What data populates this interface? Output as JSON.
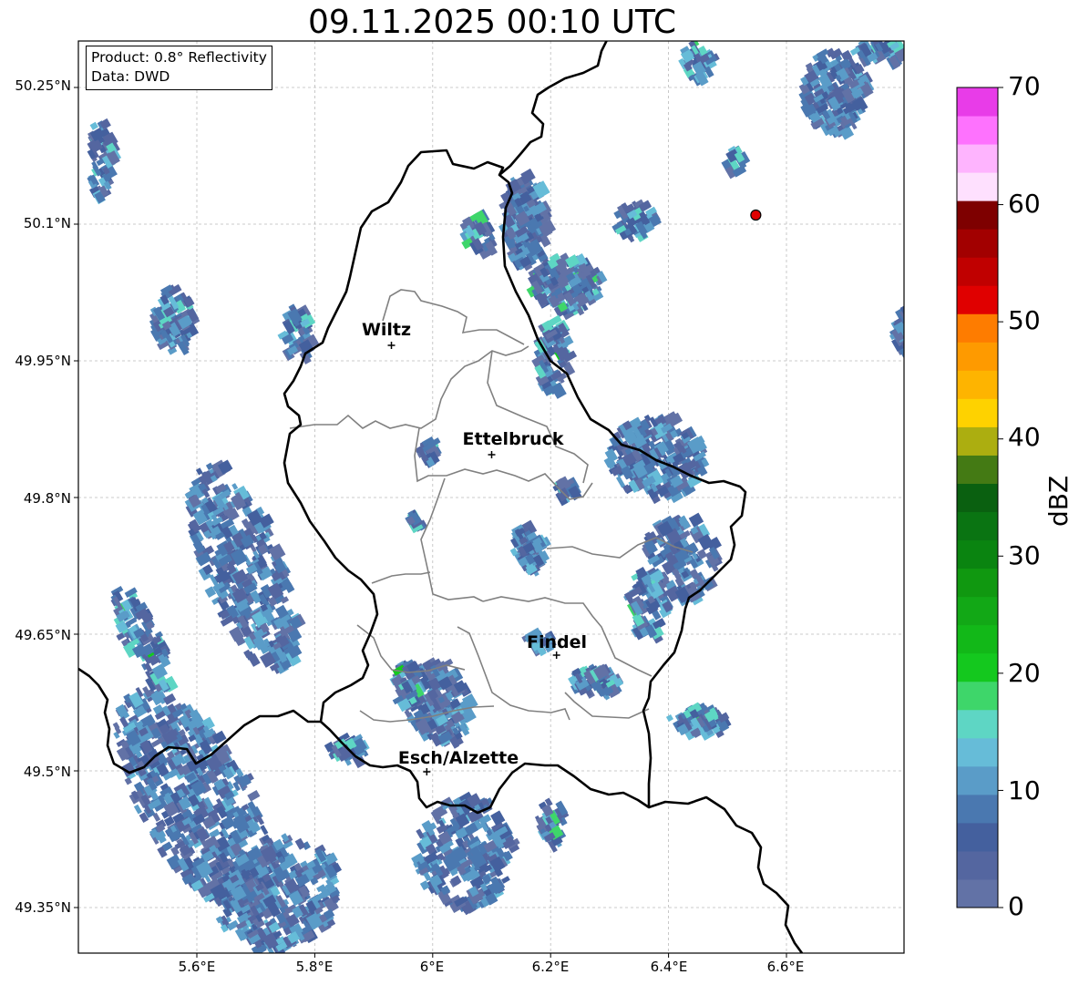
{
  "title": "09.11.2025 00:10 UTC",
  "info": {
    "product": "Product: 0.8° Reflectivity",
    "data": "Data: DWD"
  },
  "axes": {
    "lat_ticks": [
      "50.25°N",
      "50.1°N",
      "49.95°N",
      "49.8°N",
      "49.65°N",
      "49.5°N",
      "49.35°N"
    ],
    "lon_ticks": [
      "5.6°E",
      "5.8°E",
      "6°E",
      "6.2°E",
      "6.4°E",
      "6.6°E"
    ]
  },
  "cities": [
    {
      "name": "Wiltz",
      "lon": 5.93,
      "lat": 49.967
    },
    {
      "name": "Ettelbruck",
      "lon": 6.1,
      "lat": 49.847
    },
    {
      "name": "Findel",
      "lon": 6.21,
      "lat": 49.627
    },
    {
      "name": "Esch/Alzette",
      "lon": 5.99,
      "lat": 49.499
    }
  ],
  "radar_site": {
    "lon": 6.548,
    "lat": 50.11,
    "color": "#e00000"
  },
  "colorbar": {
    "label": "dBZ",
    "ticks": [
      "0",
      "10",
      "20",
      "30",
      "40",
      "50",
      "60",
      "70"
    ],
    "colors": [
      "#6272a6",
      "#5466a0",
      "#44609e",
      "#4a78b0",
      "#5a9cc8",
      "#66bcd8",
      "#5ed6c4",
      "#3ed66a",
      "#14c81e",
      "#12b818",
      "#12a816",
      "#109810",
      "#0a8410",
      "#0a7412",
      "#0a6010",
      "#447a14",
      "#acae10",
      "#fed200",
      "#feb400",
      "#fe9a00",
      "#fe7c00",
      "#e00000",
      "#c00000",
      "#a20000",
      "#7e0000",
      "#fee0fe",
      "#feb4fe",
      "#fe72fe",
      "#e83ce8"
    ]
  },
  "colors": {
    "country_border": "#000000",
    "canton_border": "#808080"
  }
}
